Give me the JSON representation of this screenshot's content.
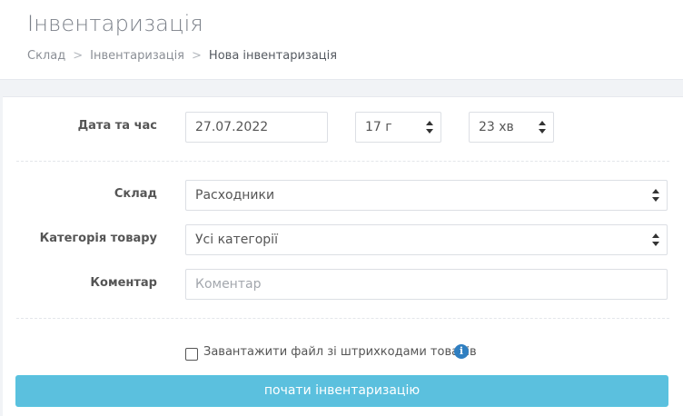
{
  "header": {
    "title": "Інвентаризація",
    "breadcrumb": [
      "Склад",
      "Інвентаризація",
      "Нова інвентаризація"
    ]
  },
  "form": {
    "datetime": {
      "label": "Дата та час",
      "date_value": "27.07.2022",
      "hour_value": "17 г",
      "minute_value": "23 хв"
    },
    "warehouse": {
      "label": "Склад",
      "value": "Расходники"
    },
    "category": {
      "label": "Категорія товару",
      "value": "Усі категорії"
    },
    "comment": {
      "label": "Коментар",
      "placeholder": "Коментар"
    },
    "barcode_checkbox": {
      "label": "Завантажити файл зі штрихкодами товарів",
      "checked": false
    },
    "submit_label": "почати інвентаризацію"
  },
  "icons": {
    "info": "info-icon"
  },
  "colors": {
    "primary_button": "#5bc0de",
    "info_icon": "#2f7fc1"
  }
}
